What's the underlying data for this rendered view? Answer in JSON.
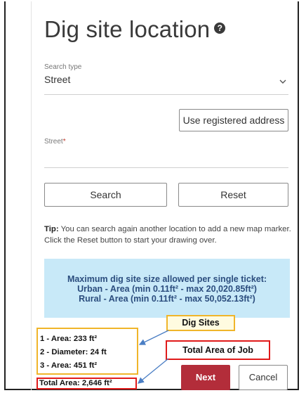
{
  "title": "Dig site location",
  "search_type": {
    "label": "Search type",
    "value": "Street"
  },
  "use_registered_address_label": "Use registered address",
  "street": {
    "label": "Street",
    "required_mark": "*",
    "value": ""
  },
  "search_label": "Search",
  "reset_label": "Reset",
  "tip": {
    "prefix": "Tip:",
    "text": " You can search again another location to add a new map marker. Click the Reset button to start your drawing over."
  },
  "info": {
    "line1": "Maximum dig site size allowed per single ticket:",
    "line2": "Urban - Area (min 0.11ft² - max 20,020.85ft²)",
    "line3": "Rural - Area (min 0.11ft² - max 50,052.13ft²)"
  },
  "dig_sites": [
    "1 - Area: 233 ft²",
    "2 - Diameter: 24 ft",
    "3 - Area: 451 ft²"
  ],
  "total_area": "Total Area: 2,646 ft²",
  "callouts": {
    "dig_sites": "Dig Sites",
    "total_area": "Total Area of Job"
  },
  "next_label": "Next",
  "cancel_label": "Cancel",
  "colors": {
    "info_bg": "#c8e9f8",
    "info_text": "#2b4d7e",
    "next_bg": "#b32d3a",
    "highlight_yellow": "#f0b52a",
    "highlight_red": "#e01a1a"
  }
}
